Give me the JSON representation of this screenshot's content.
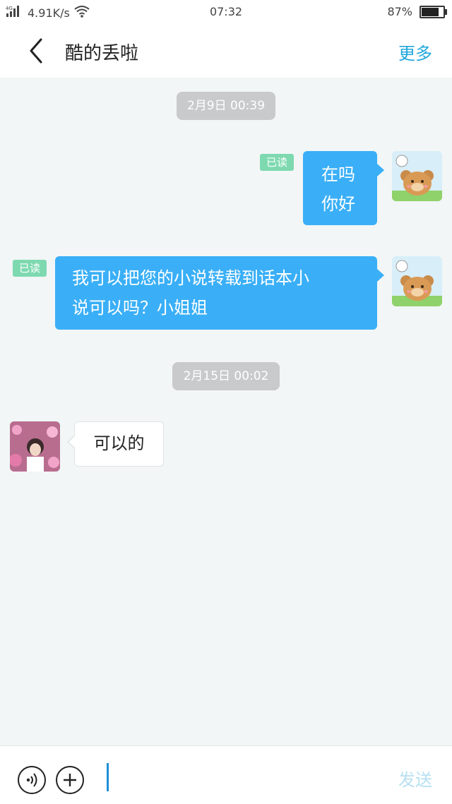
{
  "status_bar": {
    "network": "4G",
    "speed": "4.91K/s",
    "time": "07:32",
    "battery_text": "87%",
    "battery_level": 0.87
  },
  "nav": {
    "title": "酷的丢啦",
    "more": "更多"
  },
  "messages": {
    "time1": "2月9日 00:39",
    "read1": "已读",
    "msg1_line1": "在吗",
    "msg1_line2": "你好",
    "read2": "已读",
    "msg2_line1": "我可以把您的小说转载到话本小",
    "msg2_line2": "说可以吗？小姐姐",
    "time2": "2月15日 00:02",
    "reply": "可以的"
  },
  "input": {
    "placeholder": "",
    "send": "发送"
  },
  "colors": {
    "accent": "#21a7dd",
    "bubble_out": "#3aaff7",
    "read_tag": "#7ed9b0"
  }
}
